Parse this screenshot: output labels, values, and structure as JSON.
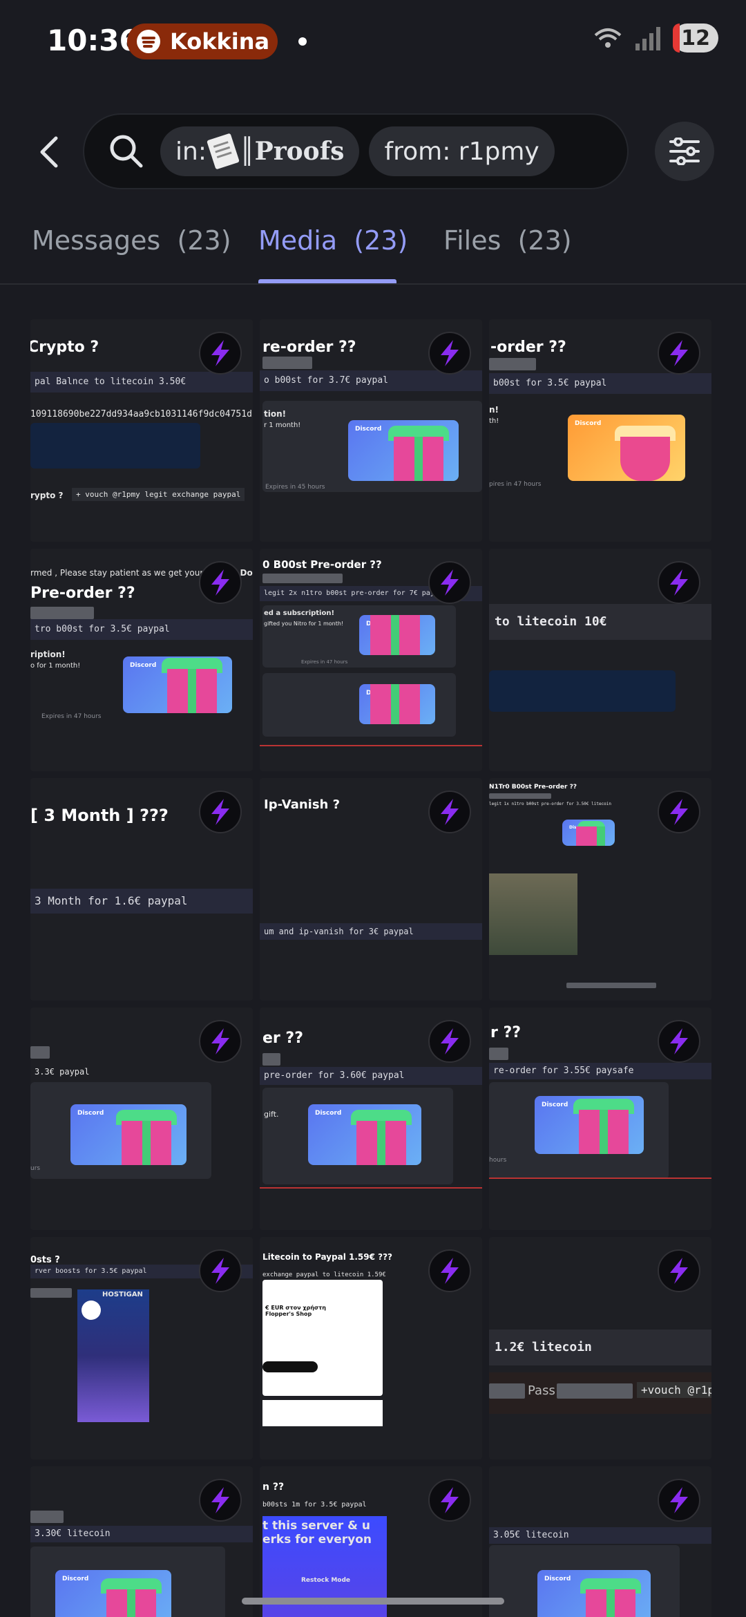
{
  "status": {
    "time": "10:36",
    "now_playing": "Kokkina M",
    "badge": "12",
    "icons": [
      "spotify-icon",
      "wifi-icon",
      "signal-icon",
      "battery-icon"
    ]
  },
  "search": {
    "chip_in_prefix": "in:",
    "chip_in_channel": "║Proofs",
    "chip_from": "from: r1pmy"
  },
  "tabs": [
    {
      "label": "Messages",
      "count": "(23)"
    },
    {
      "label": "Media",
      "count": "(23)"
    },
    {
      "label": "Files",
      "count": "(23)"
    }
  ],
  "accent": "#949cf7",
  "cells": [
    {
      "title": "Crypto ?",
      "code": "pal Balnce to litecoin 3.50€",
      "hash": "109118690be227dd934aa9cb1031146f9dc04751d",
      "vouch": "+ vouch @r1pmy legit exchange paypal",
      "tail": "rypto ?"
    },
    {
      "title": "re-order ??",
      "code": "o b00st for 3.7€ paypal",
      "t1": "tion!",
      "t2": "r 1 month!",
      "sub": "Expires in 45 hours"
    },
    {
      "title": "-order ??",
      "code": "b00st for 3.5€ paypal",
      "t1": "n!",
      "t2": "th!",
      "sub": "pires in 47 hours"
    },
    {
      "top": "rmed , Please stay patient as we get your product",
      "top2": "ase Do I",
      "title": "Pre-order ??",
      "code": "tro b00st for 3.5€ paypal",
      "t1": "ription!",
      "t2": "o for 1 month!",
      "sub": "Expires in 47 hours"
    },
    {
      "title": "0 B00st Pre-order ??",
      "code": "legit 2x n1tro b00st pre-order for 7€ paypal",
      "t1": "ed a subscription!",
      "t2": "gifted you Nitro for 1 month!",
      "sub": "Expires in 47 hours"
    },
    {
      "code": "to litecoin 10€"
    },
    {
      "title": "[ 3 Month ] ???",
      "code": "3 Month for 1.6€ paypal"
    },
    {
      "title": "Ip-Vanish ?",
      "code": "um and ip-vanish for 3€ paypal"
    },
    {
      "title": "N1Tr0 B00st Pre-order ??",
      "code": "legit 1x n1tro b00st pre-order for 3.50€ litecoin"
    },
    {
      "code": "3.3€ paypal",
      "sub": "urs"
    },
    {
      "title": "er ??",
      "code": "pre-order for 3.60€ paypal",
      "t1": "gift."
    },
    {
      "title": "r ??",
      "code": "re-order for 3.55€ paysafe",
      "sub": "hours"
    },
    {
      "title": "0sts ?",
      "code": "rver boosts for 3.5€ paypal",
      "brand": "HOSTIGAN"
    },
    {
      "title": "Litecoin to Paypal 1.59€ ???",
      "code": "exchange paypal to litecoin 1.59€",
      "shop": "€ EUR στον χρήστη Flopper's Shop"
    },
    {
      "code": "1.2€ litecoin",
      "pass": "Pass:",
      "vouch": "+vouch @r1p"
    },
    {
      "code": "3.30€ litecoin"
    },
    {
      "title": "n ??",
      "code": "b00sts 1m for 3.5€ paypal",
      "promo": "t this server & u erks for everyon",
      "server": "Restock Mode"
    },
    {
      "code": "3.05€ litecoin"
    }
  ]
}
